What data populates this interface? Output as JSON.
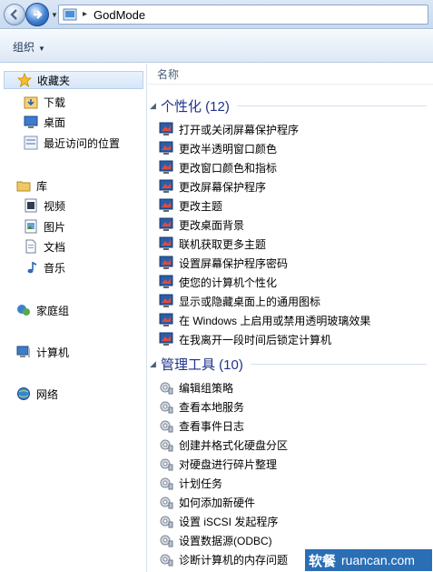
{
  "address": {
    "path": "GodMode"
  },
  "toolbar": {
    "organize_label": "组织"
  },
  "sidebar": {
    "favorites": {
      "label": "收藏夹",
      "items": [
        "下载",
        "桌面",
        "最近访问的位置"
      ]
    },
    "libraries": {
      "label": "库",
      "items": [
        "视频",
        "图片",
        "文档",
        "音乐"
      ]
    },
    "homegroup": "家庭组",
    "computer": "计算机",
    "network": "网络"
  },
  "main": {
    "column_name": "名称",
    "groups": [
      {
        "title": "个性化 (12)",
        "items": [
          "打开或关闭屏幕保护程序",
          "更改半透明窗口颜色",
          "更改窗口颜色和指标",
          "更改屏幕保护程序",
          "更改主题",
          "更改桌面背景",
          "联机获取更多主题",
          "设置屏幕保护程序密码",
          "使您的计算机个性化",
          "显示或隐藏桌面上的通用图标",
          "在 Windows 上启用或禁用透明玻璃效果",
          "在我离开一段时间后锁定计算机"
        ]
      },
      {
        "title": "管理工具 (10)",
        "items": [
          "编辑组策略",
          "查看本地服务",
          "查看事件日志",
          "创建并格式化硬盘分区",
          "对硬盘进行碎片整理",
          "计划任务",
          "如何添加新硬件",
          "设置 iSCSI 发起程序",
          "设置数据源(ODBC)",
          "诊断计算机的内存问题"
        ]
      }
    ]
  },
  "watermark": {
    "cn": "软餐",
    "en": "ruancan.com"
  },
  "colors": {
    "group_title": "#1e3287",
    "watermark_bg": "#2a6fb6"
  }
}
